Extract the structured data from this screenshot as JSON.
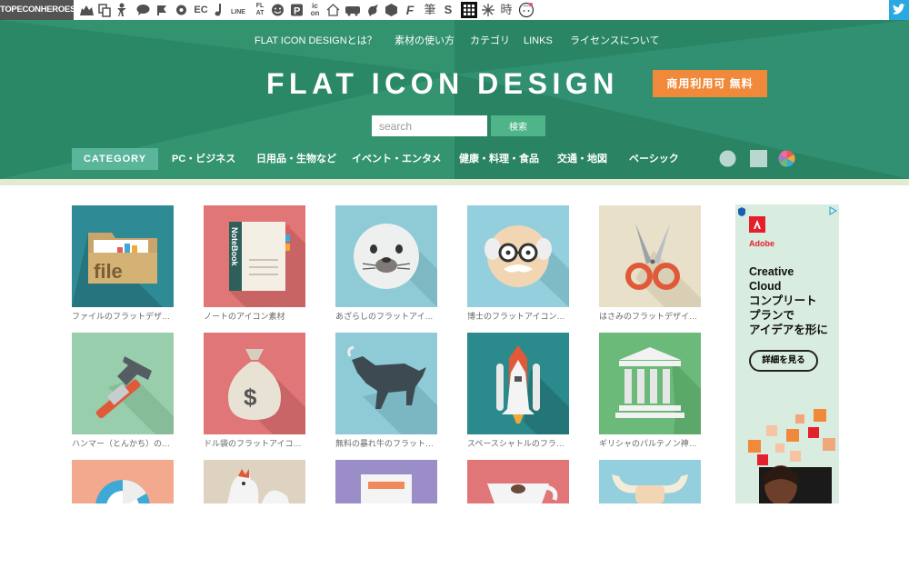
{
  "topbar": {
    "brand": "TOPECONHEROES",
    "icons": [
      "cat-icon",
      "copy-icon",
      "person-icon",
      "speech-bubble-icon",
      "flag-icon",
      "cog-icon",
      "ec-icon",
      "music-note-icon",
      "line-icon",
      "flat-icon",
      "smile-icon",
      "parking-icon",
      "icon-logo-icon",
      "house-icon",
      "train-icon",
      "bird-icon",
      "hexagon-icon",
      "f-logo-icon",
      "brush-icon",
      "s-logo-icon",
      "grid-icon",
      "sparkle-icon",
      "clock-icon",
      "girl-icon",
      "twitter-icon"
    ],
    "ec": "EC",
    "line": "LINE",
    "flat1": "FL",
    "flat2": "AT",
    "ic1": "ic",
    "ic2": "on",
    "fude": "筆",
    "s": "S",
    "toki": "時",
    "f": "F"
  },
  "header": {
    "nav": [
      "FLAT ICON DESIGNとは？",
      "素材の使い方",
      "カテゴリ",
      "LINKS",
      "ライセンスについて"
    ],
    "title": "FLAT ICON DESIGN",
    "badge": "商用利用可 無料",
    "search": {
      "placeholder": "search",
      "button": "検索"
    },
    "category_label": "CATEGORY",
    "categories": [
      "PC・ビジネス",
      "日用品・生物など",
      "イベント・エンタメ",
      "健康・料理・食品",
      "交通・地図",
      "ベーシック"
    ],
    "style_options": [
      "circle-style",
      "square-style",
      "multicolor-style"
    ],
    "colors": {
      "main": "#2e8c6a",
      "accent": "#f08a3a",
      "category": "#5bb59a",
      "search_button": "#4fb589"
    }
  },
  "grid": {
    "items": [
      {
        "caption": "ファイルのフラットデザ…",
        "icon": "file-folder-icon",
        "bg": "#2e8a94"
      },
      {
        "caption": "ノートのアイコン素材",
        "icon": "notebook-icon",
        "bg": "#e07676"
      },
      {
        "caption": "あざらしのフラットアイ…",
        "icon": "seal-icon",
        "bg": "#8fcbd6"
      },
      {
        "caption": "博士のフラットアイコン…",
        "icon": "professor-icon",
        "bg": "#93cfdc"
      },
      {
        "caption": "はさみのフラットデザイ…",
        "icon": "scissors-icon",
        "bg": "#e8e0c8"
      },
      {
        "caption": "ハンマー（とんかち）の…",
        "icon": "hammer-icon",
        "bg": "#98ceab"
      },
      {
        "caption": "ドル袋のフラットアイコ…",
        "icon": "money-bag-icon",
        "bg": "#e07678"
      },
      {
        "caption": "無料の暴れ牛のフラット…",
        "icon": "bull-icon",
        "bg": "#8fcbd6"
      },
      {
        "caption": "スペースシャトルのフラ…",
        "icon": "space-shuttle-icon",
        "bg": "#2a8a8c"
      },
      {
        "caption": "ギリシャのパルテノン神…",
        "icon": "parthenon-icon",
        "bg": "#6cba7a"
      },
      {
        "caption": "",
        "icon": "chart-icon",
        "bg": "#f2a98d"
      },
      {
        "caption": "",
        "icon": "rooster-icon",
        "bg": "#ddd3c0"
      },
      {
        "caption": "",
        "icon": "laptop-icon",
        "bg": "#9b8ec8"
      },
      {
        "caption": "",
        "icon": "coffee-cup-icon",
        "bg": "#e07678"
      },
      {
        "caption": "",
        "icon": "horns-icon",
        "bg": "#93cfdc"
      }
    ]
  },
  "ad": {
    "brand": "Adobe",
    "headline": "Creative\nCloud\nコンプリート\nプランで\nアイデアを形に",
    "cta": "詳細を見る"
  }
}
